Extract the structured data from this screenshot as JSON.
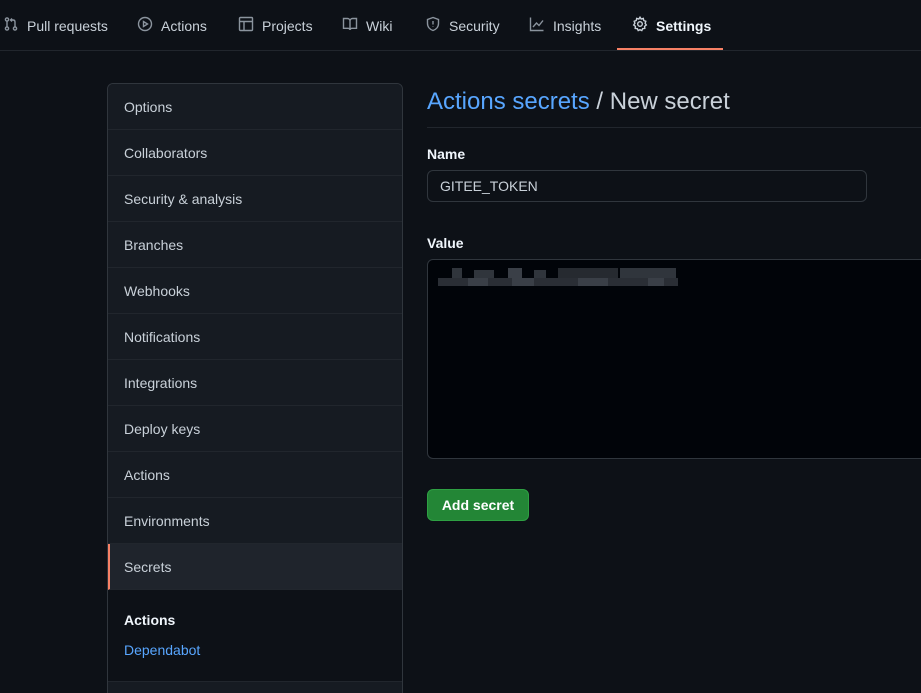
{
  "nav": {
    "tabs": [
      {
        "label": "Pull requests",
        "icon": "pull-request-icon"
      },
      {
        "label": "Actions",
        "icon": "play-icon"
      },
      {
        "label": "Projects",
        "icon": "project-table-icon"
      },
      {
        "label": "Wiki",
        "icon": "book-icon"
      },
      {
        "label": "Security",
        "icon": "shield-icon"
      },
      {
        "label": "Insights",
        "icon": "graph-icon"
      },
      {
        "label": "Settings",
        "icon": "gear-icon"
      }
    ],
    "active_tab": "Settings"
  },
  "sidebar": {
    "items": [
      {
        "label": "Options"
      },
      {
        "label": "Collaborators"
      },
      {
        "label": "Security & analysis"
      },
      {
        "label": "Branches"
      },
      {
        "label": "Webhooks"
      },
      {
        "label": "Notifications"
      },
      {
        "label": "Integrations"
      },
      {
        "label": "Deploy keys"
      },
      {
        "label": "Actions"
      },
      {
        "label": "Environments"
      },
      {
        "label": "Secrets"
      }
    ],
    "selected": "Secrets",
    "sub_heading": "Actions",
    "sub_link": "Dependabot"
  },
  "main": {
    "breadcrumb_link": "Actions secrets",
    "breadcrumb_sep": " / ",
    "breadcrumb_current": "New secret",
    "name_label": "Name",
    "name_value": "GITEE_TOKEN",
    "value_label": "Value",
    "add_button": "Add secret"
  },
  "colors": {
    "accent_link": "#58a6ff",
    "active_underline": "#f78166",
    "primary_button": "#238636",
    "background": "#0d1117"
  }
}
